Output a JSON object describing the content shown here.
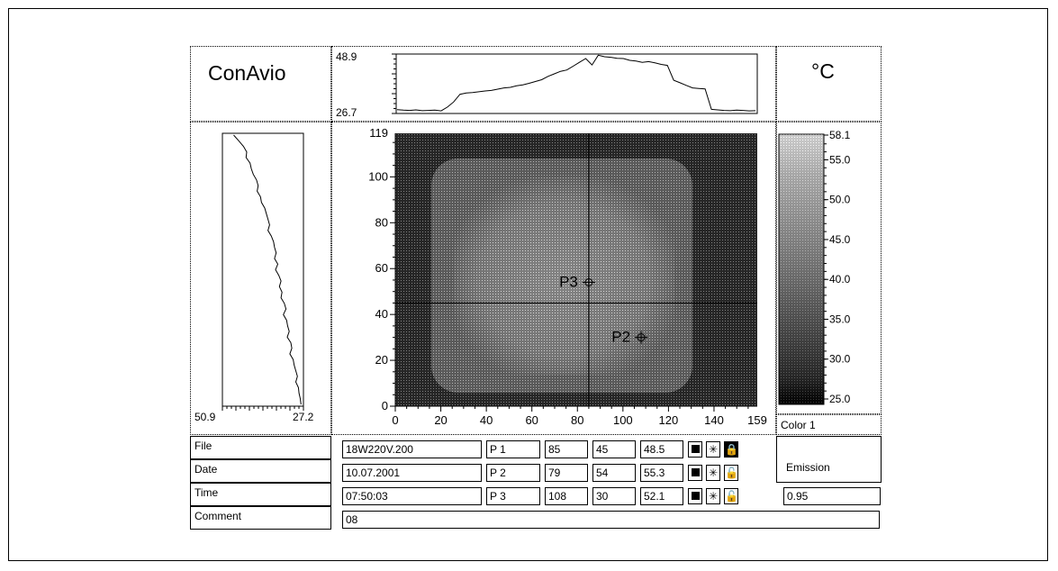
{
  "app": {
    "logo": "ConAvio",
    "unit": "°C"
  },
  "top_profile": {
    "max_label": "48.9",
    "min_label": "26.7",
    "values": [
      27.5,
      27.3,
      27.2,
      27.4,
      27.1,
      27.2,
      27.3,
      27.0,
      28.5,
      30.5,
      33.5,
      34.0,
      34.2,
      34.5,
      34.8,
      35.0,
      35.5,
      36.0,
      36.2,
      36.8,
      37.2,
      37.8,
      38.5,
      39.2,
      40.5,
      41.5,
      42.5,
      43.0,
      44.5,
      46.0,
      47.5,
      45.0,
      48.8,
      48.2,
      48.0,
      47.6,
      47.5,
      46.8,
      46.5,
      46.0,
      46.3,
      45.8,
      45.2,
      44.8,
      39.0,
      38.0,
      37.0,
      36.0,
      35.8,
      35.6,
      27.6,
      27.4,
      27.2,
      27.1,
      27.3,
      27.2,
      27.0,
      27.1
    ]
  },
  "left_profile": {
    "min_label": "50.9",
    "max_label": "27.2",
    "values": [
      48.0,
      46.5,
      45.0,
      44.0,
      44.2,
      43.0,
      42.6,
      42.0,
      41.0,
      40.5,
      40.8,
      39.8,
      39.5,
      38.5,
      38.0,
      37.5,
      37.0,
      37.5,
      36.5,
      35.8,
      35.5,
      35.0,
      35.5,
      34.5,
      35.2,
      34.2,
      33.5,
      34.0,
      33.2,
      33.5,
      32.5,
      32.0,
      32.8,
      31.8,
      31.5,
      31.0,
      31.6,
      30.5,
      30.2,
      30.8,
      29.8,
      29.5,
      29.0,
      28.5,
      29.0,
      28.2,
      28.0,
      27.6,
      27.4
    ]
  },
  "thermogram": {
    "x_ticks": [
      "0",
      "20",
      "40",
      "60",
      "80",
      "100",
      "120",
      "140",
      "159"
    ],
    "y_ticks": [
      "119",
      "100",
      "80",
      "60",
      "40",
      "20",
      "0"
    ],
    "points": [
      {
        "label": "P3",
        "x": 85,
        "y": 54
      },
      {
        "label": "P2",
        "x": 108,
        "y": 30
      }
    ],
    "cursor": {
      "x": 85,
      "y": 45
    }
  },
  "scale": {
    "labels": [
      "58.1",
      "55.0",
      "50.0",
      "45.0",
      "40.0",
      "35.0",
      "30.0",
      "25.0"
    ],
    "palette": "Color 1"
  },
  "info": {
    "file_label": "File",
    "file_value": "18W220V.200",
    "date_label": "Date",
    "date_value": "10.07.2001",
    "time_label": "Time",
    "time_value": "07:50:03",
    "comment_label": "Comment",
    "comment_value": "08",
    "emission_label": "Emission",
    "emission_value": "0.95",
    "points": [
      {
        "name": "P 1",
        "x": "85",
        "y": "45",
        "temp": "48.5",
        "lock": "locked"
      },
      {
        "name": "P 2",
        "x": "79",
        "y": "54",
        "temp": "55.3",
        "lock": "unlocked"
      },
      {
        "name": "P 3",
        "x": "108",
        "y": "30",
        "temp": "52.1",
        "lock": "unlocked"
      }
    ]
  },
  "colors": {
    "line": "#000000",
    "background": "#ffffff"
  }
}
